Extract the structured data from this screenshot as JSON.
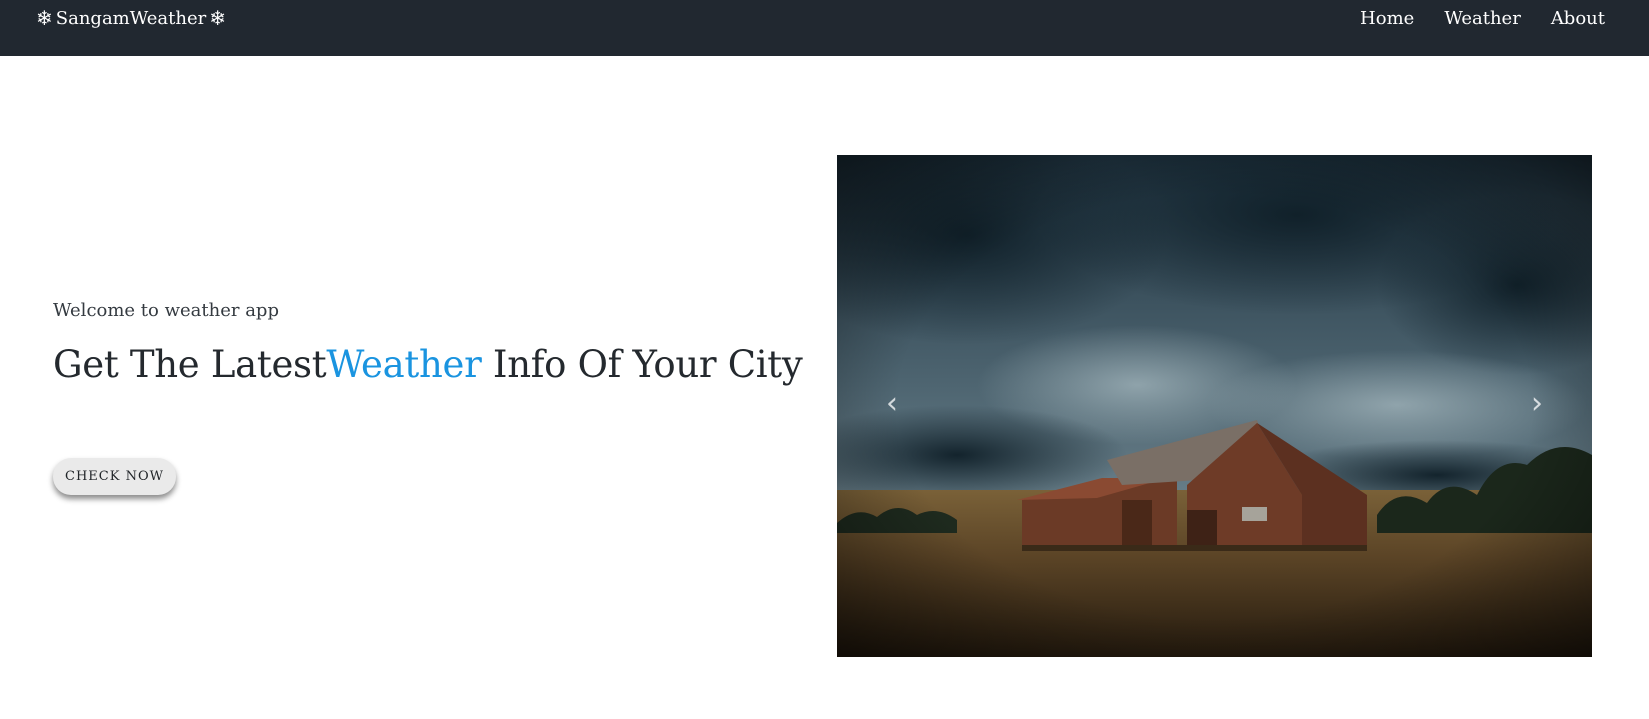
{
  "navbar": {
    "brand": "SangamWeather",
    "brand_icon": "snowflake-icon",
    "links": [
      "Home",
      "Weather",
      "About"
    ]
  },
  "hero": {
    "welcome": "Welcome to weather app",
    "headline_pre": "Get The Latest",
    "headline_accent": "Weather",
    "headline_post": " Info Of Your City",
    "cta": "CHECK NOW",
    "accent_color": "#1a94e0"
  },
  "carousel": {
    "image_alt": "Wooden barn under stormy clouds",
    "prev_icon": "chevron-left-icon",
    "next_icon": "chevron-right-icon"
  }
}
